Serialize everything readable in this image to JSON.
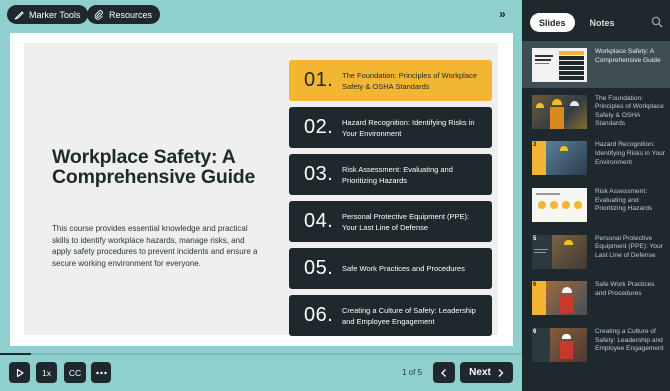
{
  "toolbar": {
    "marker_tools_label": "Marker Tools",
    "resources_label": "Resources",
    "collapse_icon": "double-chevron-right-icon"
  },
  "slide": {
    "title": "Workplace Safety: A Comprehensive Guide",
    "description": "This course provides essential knowledge and practical skills to identify workplace hazards, manage risks, and apply safety procedures to prevent incidents and ensure a secure working environment for everyone.",
    "toc": [
      {
        "num": "01.",
        "text": "The Foundation: Principles of Workplace Safety & OSHA Standards",
        "active": true
      },
      {
        "num": "02.",
        "text": "Hazard Recognition: Identifying Risks in Your Environment",
        "active": false
      },
      {
        "num": "03.",
        "text": "Risk Assessment: Evaluating and Prioritizing Hazards",
        "active": false
      },
      {
        "num": "04.",
        "text": "Personal Protective Equipment (PPE): Your Last Line of Defense",
        "active": false
      },
      {
        "num": "05.",
        "text": "Safe Work Practices and Procedures",
        "active": false
      },
      {
        "num": "06.",
        "text": "Creating a Culture of Safety: Leadership and Employee Engagement",
        "active": false
      }
    ]
  },
  "progress": {
    "fraction": 0.06
  },
  "controls": {
    "play_icon": "play-icon",
    "speed_label": "1x",
    "cc_label": "CC",
    "more_icon": "more-dots-icon",
    "page_indicator": "1 of 5",
    "prev_icon": "chevron-left-icon",
    "next_label": "Next"
  },
  "sidebar": {
    "tabs": [
      {
        "label": "Slides",
        "active": true
      },
      {
        "label": "Notes",
        "active": false
      }
    ],
    "search_icon": "search-icon",
    "thumbnails": [
      {
        "label": "Workplace Safety: A Comprehensive Guide",
        "num": "",
        "active": true
      },
      {
        "label": "The Foundation: Principles of Workplace Safety & OSHA Standards",
        "num": "",
        "active": false
      },
      {
        "label": "Hazard Recognition: Identifying Risks in Your Environment",
        "num": "3",
        "active": false
      },
      {
        "label": "Risk Assessment: Evaluating and Prioritizing Hazards",
        "num": "",
        "active": false
      },
      {
        "label": "Personal Protective Equipment (PPE): Your Last Line of Defense",
        "num": "5",
        "active": false
      },
      {
        "label": "Safe Work Practices and Procedures",
        "num": "6",
        "active": false
      },
      {
        "label": "Creating a Culture of Safety: Leadership and Employee Engagement",
        "num": "6",
        "active": false
      }
    ]
  },
  "colors": {
    "background": "#8fd0cf",
    "dark": "#1f282c",
    "accent": "#f2b632",
    "sidebar_active": "#3f4e53"
  }
}
